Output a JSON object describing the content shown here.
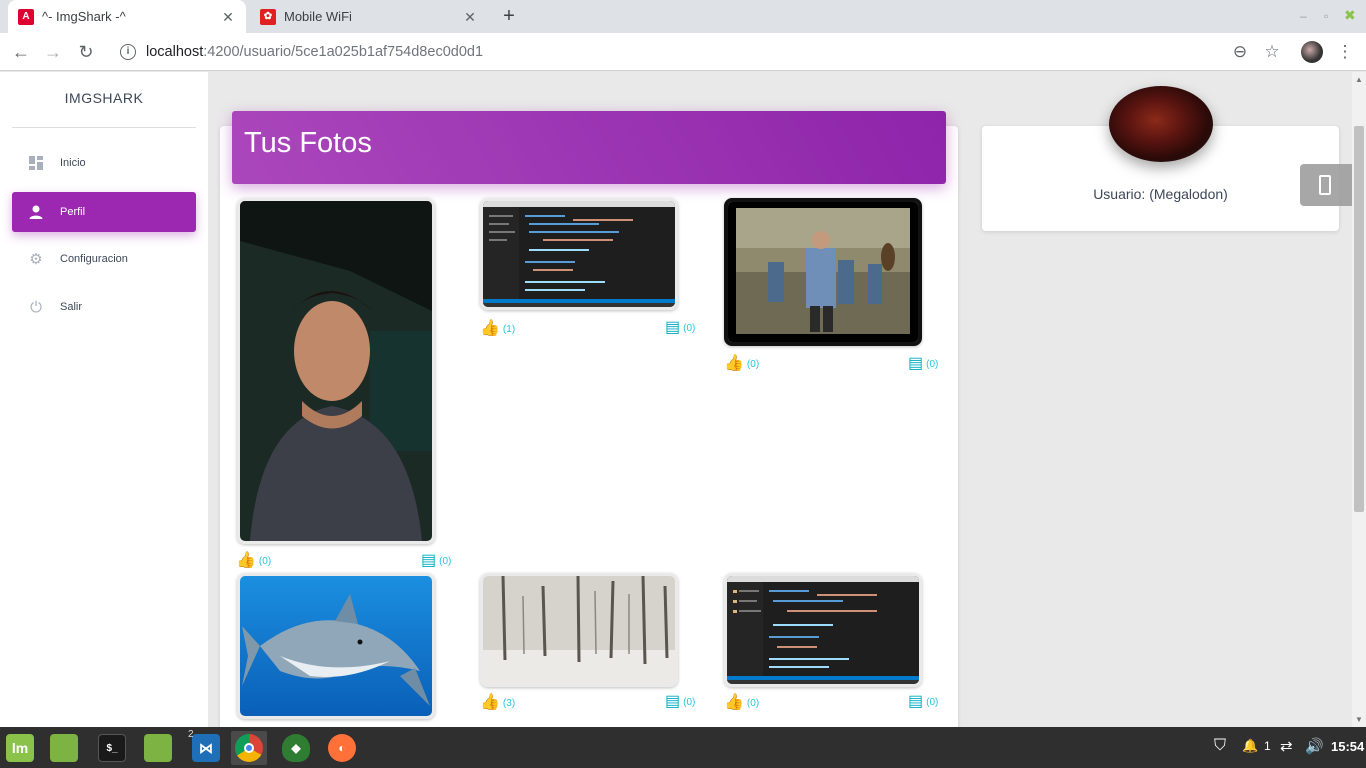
{
  "browser": {
    "tabs": [
      {
        "title": "^- ImgShark -^",
        "icon": "angular-icon",
        "active": true
      },
      {
        "title": "Mobile WiFi",
        "icon": "huawei-icon",
        "active": false
      }
    ],
    "url_host": "localhost",
    "url_path": ":4200/usuario/5ce1a025b1af754d8ec0d0d1"
  },
  "sidebar": {
    "brand": "IMGSHARK",
    "items": [
      {
        "label": "Inicio",
        "icon": "dashboard-icon",
        "active": false
      },
      {
        "label": "Perfil",
        "icon": "person-icon",
        "active": true
      },
      {
        "label": "Configuracion",
        "icon": "gear-icon",
        "active": false
      },
      {
        "label": "Salir",
        "icon": "power-icon",
        "active": false
      }
    ]
  },
  "main": {
    "title": "Tus Fotos",
    "photos": [
      {
        "subject": "selfie-photo",
        "likes": "(0)",
        "comments": "(0)"
      },
      {
        "subject": "code-editor-screenshot",
        "likes": "(1)",
        "comments": "(0)"
      },
      {
        "subject": "movie-still",
        "likes": "(0)",
        "comments": "(0)"
      },
      {
        "subject": "shark-photo",
        "likes": "",
        "comments": ""
      },
      {
        "subject": "snowy-forest-photo",
        "likes": "(3)",
        "comments": "(0)"
      },
      {
        "subject": "code-editor-screenshot",
        "likes": "(0)",
        "comments": "(0)"
      }
    ]
  },
  "profile": {
    "username": "Usuario: (Megalodon)"
  },
  "taskbar": {
    "vscode_badge": "2",
    "notification_count": "1",
    "clock": "15:54"
  },
  "colors": {
    "accent": "#9c27b0",
    "stat": "#26c6da"
  }
}
